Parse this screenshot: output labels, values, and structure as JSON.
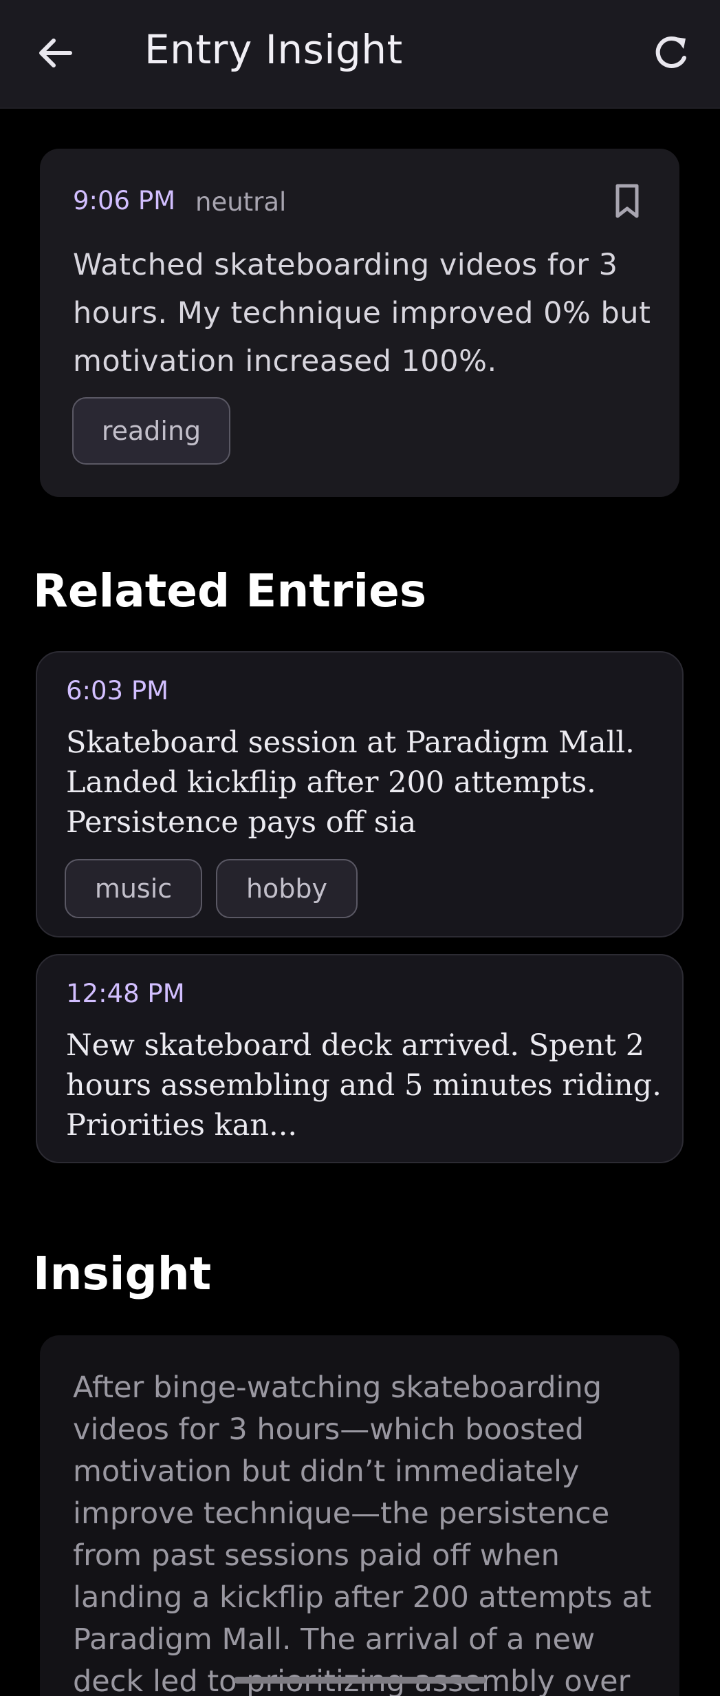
{
  "appbar": {
    "title": "Entry Insight",
    "back_icon": "arrow-left-icon",
    "refresh_icon": "refresh-icon"
  },
  "entry": {
    "time": "9:06 PM",
    "mood": "neutral",
    "bookmark_icon": "bookmark-icon",
    "content": "Watched skateboarding videos for 3 hours. My technique improved 0% but motivation increased 100%.",
    "tags": [
      "reading"
    ]
  },
  "related": {
    "title": "Related Entries",
    "items": [
      {
        "time": "6:03 PM",
        "content": "Skateboard session at Paradigm Mall. Landed kickflip after 200 attempts. Persistence pays off sia",
        "tags": [
          "music",
          "hobby"
        ]
      },
      {
        "time": "12:48 PM",
        "content": "New skateboard deck arrived. Spent 2 hours assembling and 5 minutes riding. Priorities kan...",
        "tags": []
      }
    ]
  },
  "insight": {
    "title": "Insight",
    "content": "After binge-watching skateboarding videos for 3 hours—which boosted motivation but didn’t immediately improve technique—the persistence from past sessions paid off when landing a kickflip after 200 attempts at Paradigm Mall. The arrival of a new deck led to prioritizing assembly over"
  },
  "colors": {
    "accent": "#d2bfff",
    "background": "#000000",
    "card": "#1b1a1f"
  }
}
